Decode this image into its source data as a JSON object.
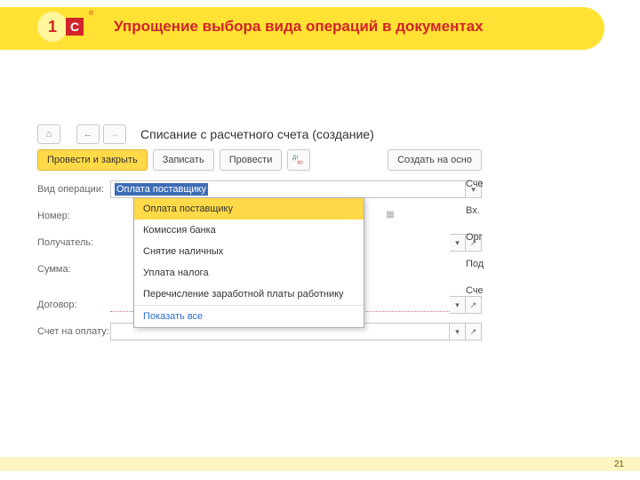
{
  "slide": {
    "title": "Упрощение выбора вида операций в документах",
    "page_number": "21"
  },
  "logo": {
    "1": "1",
    "c": "C",
    "reg": "®"
  },
  "nav": {
    "home": "⌂",
    "back": "←",
    "fwd": "→"
  },
  "doc_title": "Списание с расчетного счета (создание)",
  "toolbar": {
    "primary": "Провести и закрыть",
    "save": "Записать",
    "post": "Провести",
    "create_based": "Создать на осно"
  },
  "labels": {
    "op_type": "Вид операции:",
    "number": "Номер:",
    "payee": "Получатель:",
    "sum": "Сумма:",
    "contract": "Договор:",
    "invoice": "Счет на оплату:"
  },
  "fields": {
    "op_value": "Оплата поставщику"
  },
  "right": {
    "r1": "Сче",
    "r2": "Вх.",
    "r3": "Орг",
    "r4": "Под",
    "r5": "Сче"
  },
  "dropdown": {
    "items": [
      "Оплата поставщику",
      "Комиссия банка",
      "Снятие наличных",
      "Уплата налога",
      "Перечисление заработной платы работнику"
    ],
    "show_all": "Показать все"
  }
}
